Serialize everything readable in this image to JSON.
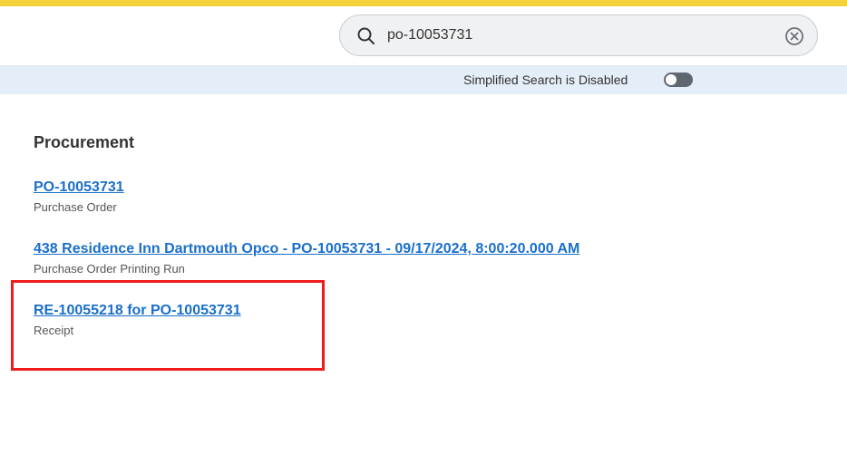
{
  "header": {
    "search": {
      "value": "po-10053731",
      "icon": "search-icon",
      "clear_icon": "clear-icon"
    }
  },
  "banner": {
    "text": "Simplified Search is Disabled",
    "toggle_state": "off"
  },
  "results": {
    "section_title": "Procurement",
    "items": [
      {
        "title": "PO-10053731",
        "subtitle": "Purchase Order"
      },
      {
        "title": "438 Residence Inn Dartmouth Opco - PO-10053731 - 09/17/2024, 8:00:20.000 AM",
        "subtitle": "Purchase Order Printing Run"
      },
      {
        "title": "RE-10055218 for PO-10053731",
        "subtitle": "Receipt"
      }
    ]
  },
  "colors": {
    "accent_bar": "#f5d13c",
    "link": "#1a6fcb",
    "banner_bg": "#e4eef8",
    "highlight": "#ee1c1c"
  }
}
